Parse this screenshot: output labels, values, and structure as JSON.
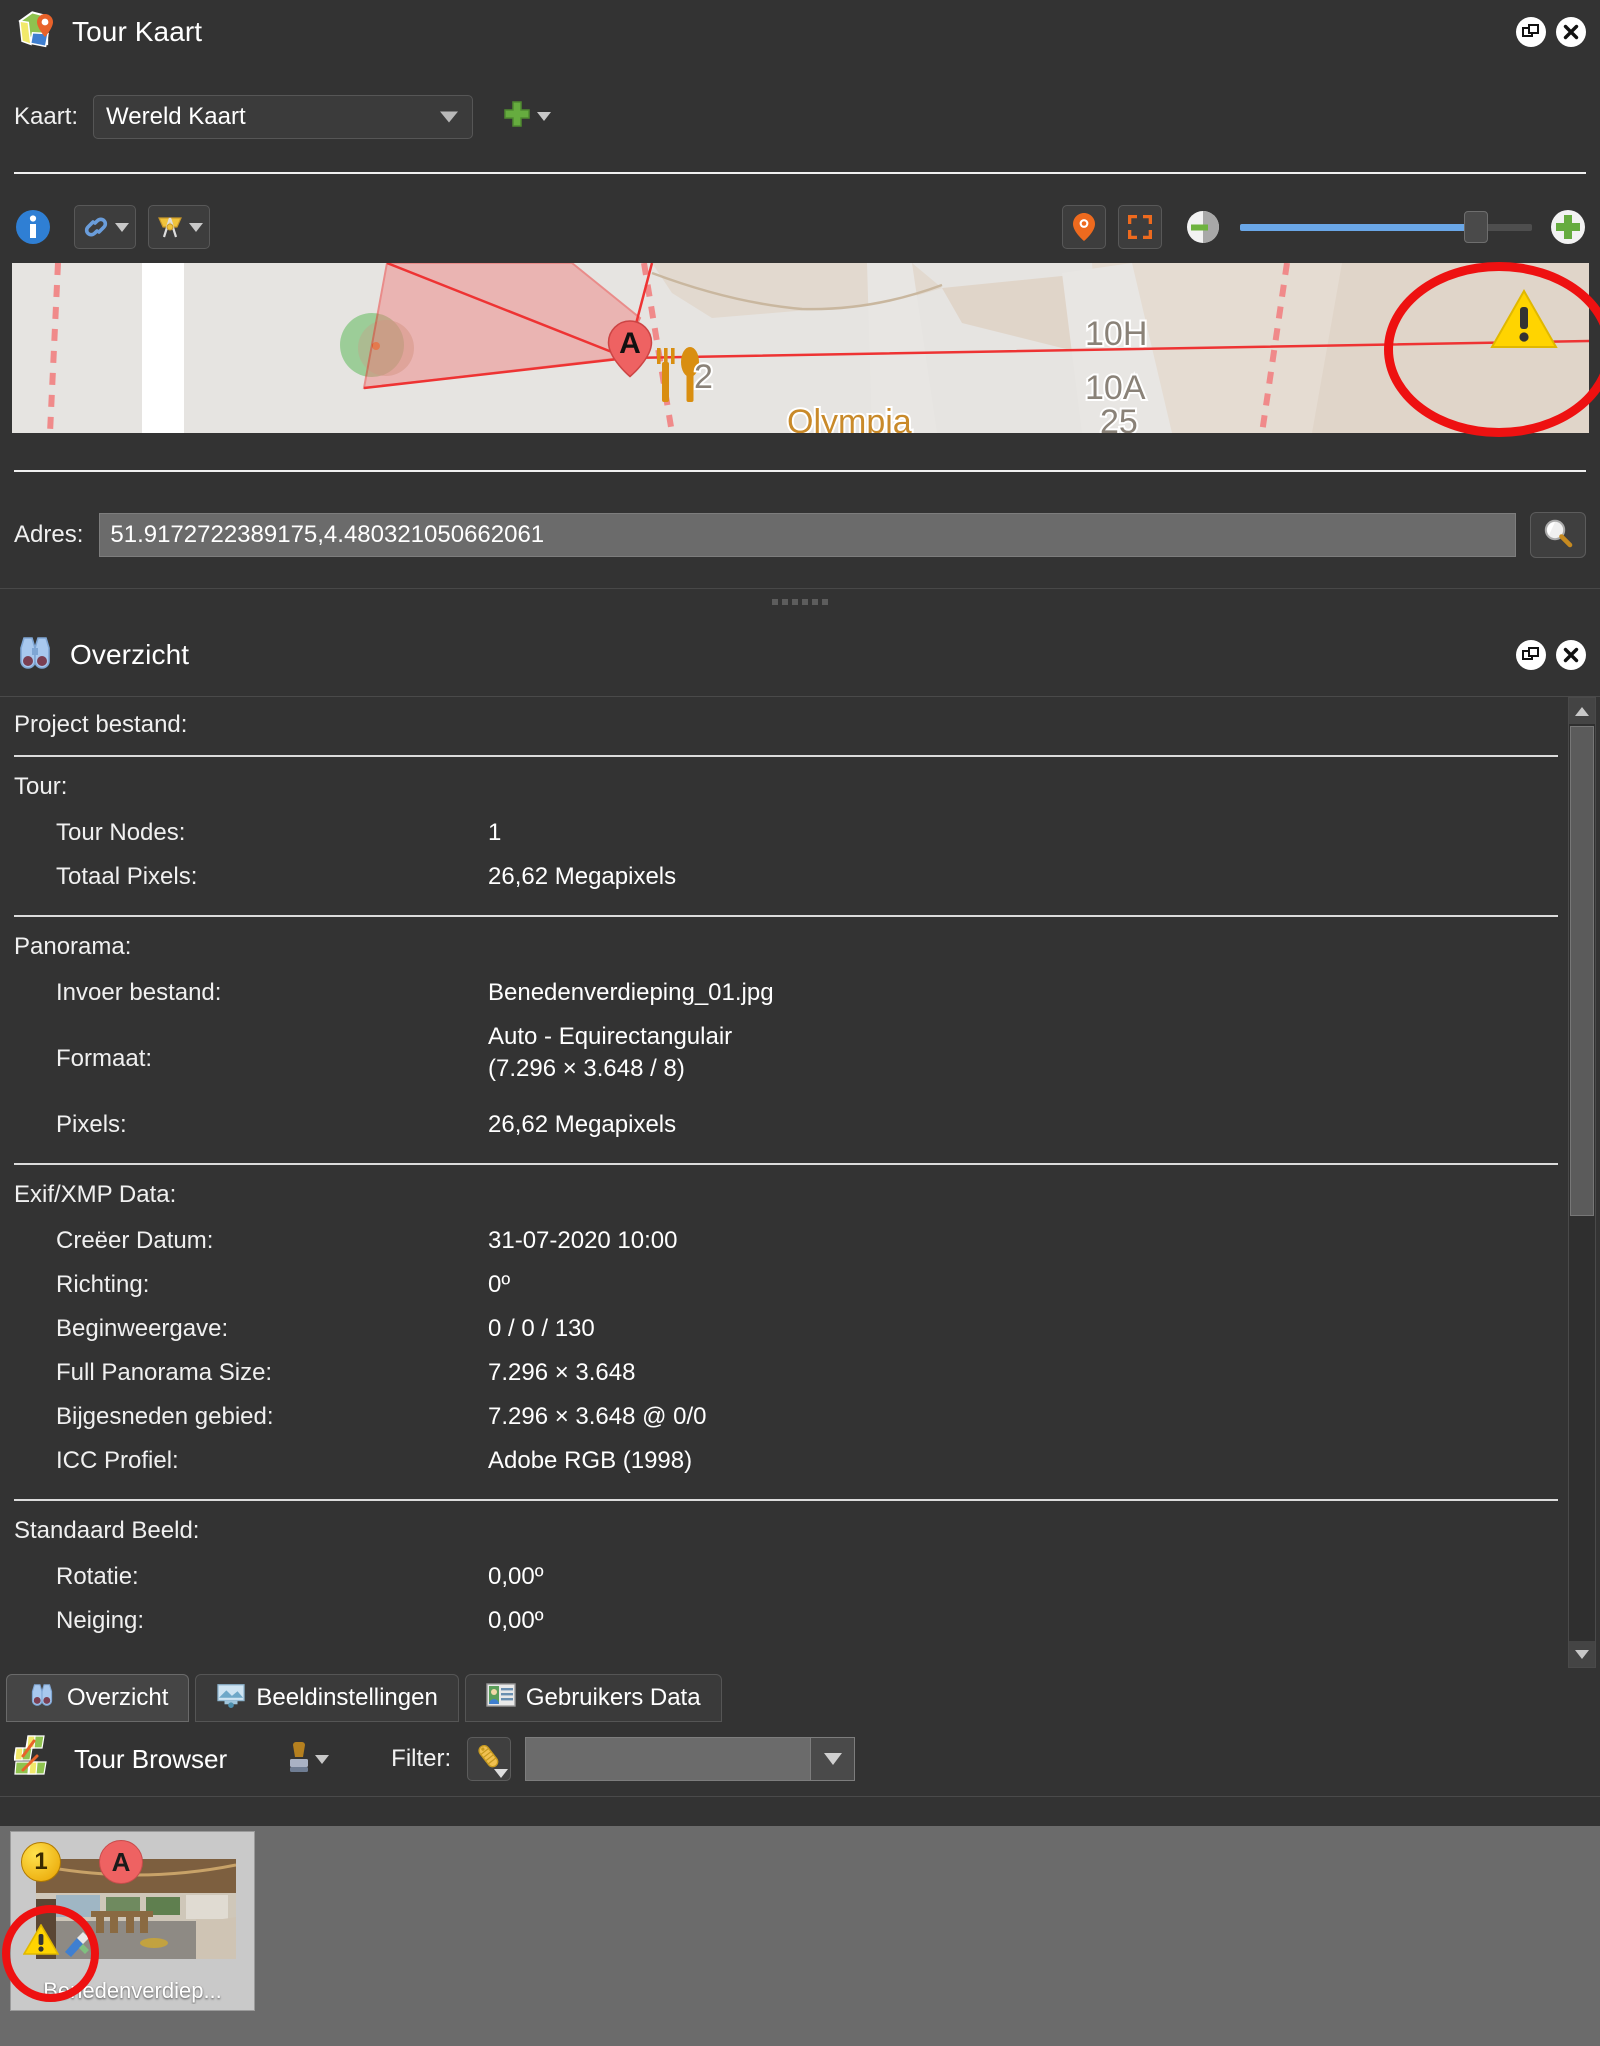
{
  "tour_kaart": {
    "title": "Tour Kaart",
    "icon": "map-pin-icon",
    "restore_icon": "restore-window-icon",
    "close_icon": "close-window-icon",
    "kaart_label": "Kaart:",
    "kaart_value": "Wereld Kaart",
    "add_label": "+",
    "toolbar": {
      "info": "info-icon",
      "link": "link-icon",
      "compass": "compass-icon",
      "marker": "map-marker-icon",
      "fullscreen": "fit-to-view-icon",
      "contrast": "contrast-icon",
      "zoom_in": "zoom-in-icon",
      "zoom_value": "84"
    },
    "map": {
      "marker_label": "A",
      "street_labels": [
        "10H",
        "10A",
        "Olympia"
      ],
      "warning_icon": "warning-triangle-icon"
    },
    "adres_label": "Adres:",
    "adres_value": "51.9172722389175,4.480321050662061",
    "adres_search_icon": "search-icon"
  },
  "overzicht": {
    "title": "Overzicht",
    "icon": "binoculars-icon",
    "restore_icon": "restore-window-icon",
    "close_icon": "close-window-icon",
    "sections": [
      {
        "title": "Project bestand:",
        "rows": []
      },
      {
        "title": "Tour:",
        "rows": [
          {
            "key": "Tour Nodes:",
            "value": "1"
          },
          {
            "key": "Totaal Pixels:",
            "value": "26,62 Megapixels"
          }
        ]
      },
      {
        "title": "Panorama:",
        "rows": [
          {
            "key": "Invoer bestand:",
            "value": "Benedenverdieping_01.jpg"
          },
          {
            "key": "Formaat:",
            "value": "Auto - Equirectangulair\n(7.296 × 3.648 / 8)",
            "two_line": true
          },
          {
            "key": "Pixels:",
            "value": "26,62 Megapixels"
          }
        ]
      },
      {
        "title": "Exif/XMP Data:",
        "rows": [
          {
            "key": "Creëer Datum:",
            "value": "31-07-2020 10:00"
          },
          {
            "key": "Richting:",
            "value": "0º"
          },
          {
            "key": "Beginweergave:",
            "value": "0 / 0 / 130"
          },
          {
            "key": "Full Panorama Size:",
            "value": "7.296 × 3.648"
          },
          {
            "key": "Bijgesneden gebied:",
            "value": "7.296 × 3.648 @ 0/0"
          },
          {
            "key": "ICC Profiel:",
            "value": "Adobe RGB (1998)"
          }
        ]
      },
      {
        "title": "Standaard Beeld:",
        "rows": [
          {
            "key": "Rotatie:",
            "value": "0,00º"
          },
          {
            "key": "Neiging:",
            "value": "0,00º"
          }
        ]
      }
    ],
    "scrollbar": {
      "up_icon": "scroll-up-arrow-icon",
      "down_icon": "scroll-down-arrow-icon"
    }
  },
  "tabs": [
    {
      "label": "Overzicht",
      "icon": "binoculars-icon",
      "active": true
    },
    {
      "label": "Beeldinstellingen",
      "icon": "image-settings-icon",
      "active": false
    },
    {
      "label": "Gebruikers Data",
      "icon": "user-card-icon",
      "active": false
    }
  ],
  "tour_browser": {
    "title": "Tour Browser",
    "icon": "tour-browser-icon",
    "stamp_icon": "stamp-icon",
    "filter_label": "Filter:",
    "filter_icon": "filter-tag-icon",
    "filter_value": "",
    "filter_placeholder": "",
    "thumbnail": {
      "label": "Benedenverdiep...",
      "number_badge": "1",
      "letter_badge": "A",
      "warning_icon": "warning-triangle-icon",
      "tool_icon": "patch-tool-icon"
    }
  },
  "annotations": {
    "highlight_color": "#ee1111",
    "circles": [
      "map-warning-highlight",
      "thumbnail-warning-highlight"
    ]
  }
}
